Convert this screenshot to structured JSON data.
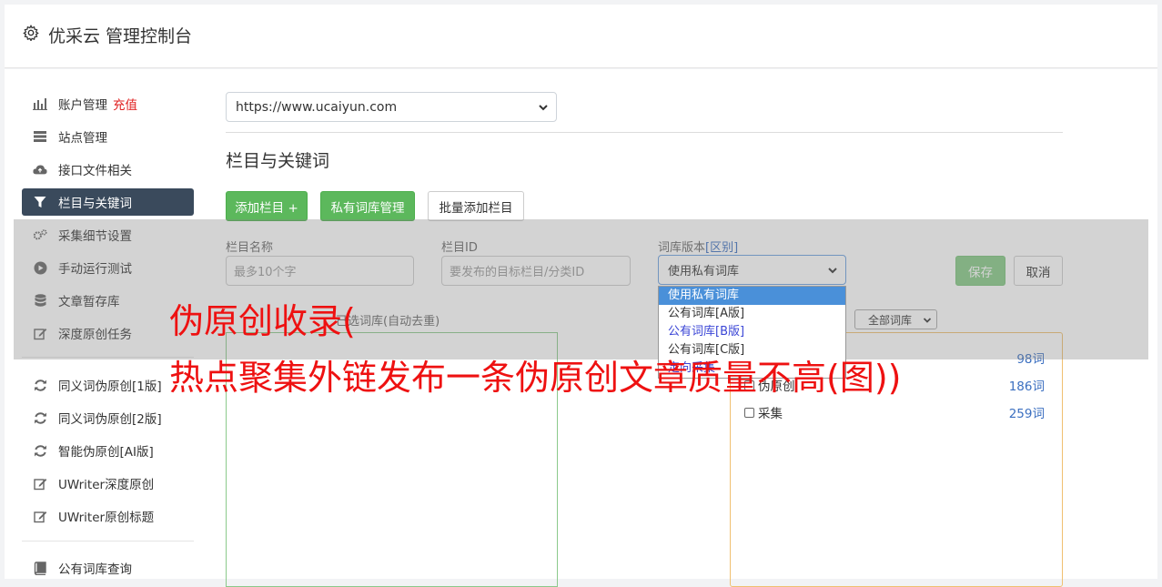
{
  "header": {
    "title": "优采云 管理控制台"
  },
  "sidebar": {
    "items": [
      {
        "label": "账户管理",
        "badge": "充值",
        "icon": "bar-chart-icon"
      },
      {
        "label": "站点管理",
        "icon": "server-icon"
      },
      {
        "label": "接口文件相关",
        "icon": "cloud-upload-icon"
      },
      {
        "label": "栏目与关键词",
        "icon": "filter-icon",
        "active": true
      },
      {
        "label": "采集细节设置",
        "icon": "cogs-icon"
      },
      {
        "label": "手动运行测试",
        "icon": "play-circle-icon"
      },
      {
        "label": "文章暂存库",
        "icon": "database-icon"
      },
      {
        "label": "深度原创任务",
        "icon": "edit-icon"
      },
      {
        "label": "同义词伪原创[1版]",
        "icon": "refresh-icon"
      },
      {
        "label": "同义词伪原创[2版]",
        "icon": "refresh-icon"
      },
      {
        "label": "智能伪原创[AI版]",
        "icon": "refresh-icon"
      },
      {
        "label": "UWriter深度原创",
        "icon": "edit-icon"
      },
      {
        "label": "UWriter原创标题",
        "icon": "edit-icon"
      },
      {
        "label": "公有词库查询",
        "icon": "book-icon"
      }
    ]
  },
  "main": {
    "site_select": {
      "value": "https://www.ucaiyun.com"
    },
    "section_title": "栏目与关键词",
    "buttons": {
      "add_column": "添加栏目 +",
      "private_lib": "私有词库管理",
      "batch_add": "批量添加栏目"
    },
    "form": {
      "name_label": "栏目名称",
      "name_placeholder": "最多10个字",
      "id_label": "栏目ID",
      "id_placeholder": "要发布的目标栏目/分类ID",
      "version_label": "词库版本",
      "version_diff": "[区别]",
      "version_value": "使用私有词库",
      "save": "保存",
      "cancel": "取消"
    },
    "dropdown_options": [
      "使用私有词库",
      "公有词库[A版]",
      "公有词库[B版]",
      "公有词库[C版]",
      "定向采集"
    ],
    "lib_label_partial": "已选词库(自动去重)",
    "all_select": "全部词库",
    "libraries": [
      {
        "name": "",
        "count": "98词"
      },
      {
        "name": "伪原创",
        "count": "186词"
      },
      {
        "name": "采集",
        "count": "259词"
      }
    ]
  },
  "overlay_text": {
    "line1": "伪原创收录(",
    "line2": "热点聚集外链发布一条伪原创文章质量不高(图))"
  },
  "colors": {
    "accent": "#5cb85c",
    "active_nav": "#3a4a5c",
    "red_text": "#ee1111",
    "link_blue": "#3b6fc0"
  }
}
